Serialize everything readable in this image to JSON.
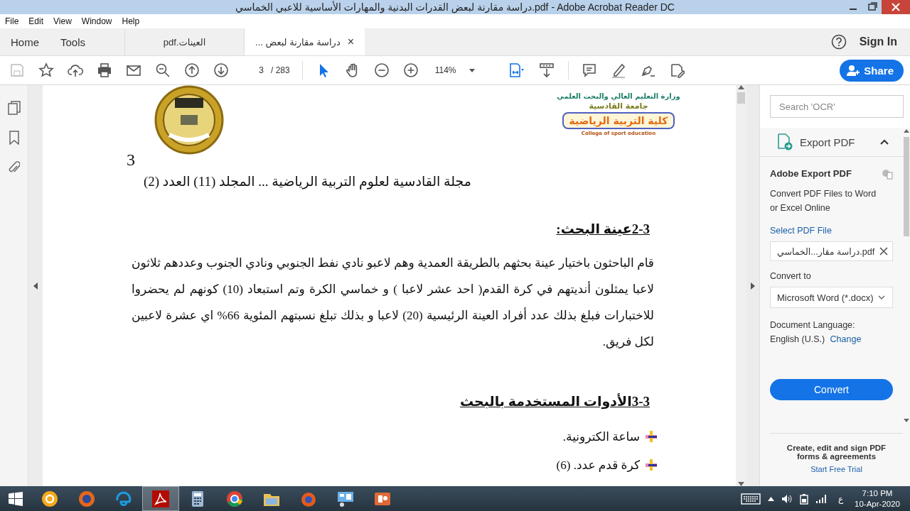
{
  "window": {
    "title": "دراسة مقارنة لبعض القدرات البدنية والمهارات الأساسية للاعبي الخماسي.pdf - Adobe Acrobat Reader DC"
  },
  "menu": {
    "file": "File",
    "edit": "Edit",
    "view": "View",
    "window": "Window",
    "help": "Help"
  },
  "home_tab": {
    "label": "Home",
    "kind": "nav",
    "selected": false
  },
  "tools_tab": {
    "label": "Tools",
    "kind": "nav",
    "selected": false
  },
  "other_document_tab": {
    "label": "العينات.pdf",
    "kind": "document",
    "selected": false
  },
  "open_document_tab": {
    "label": "دراسة مقارنة لبعض ...",
    "kind": "document",
    "selected": true,
    "close": "×"
  },
  "account": {
    "sign_in": "Sign In"
  },
  "toolbar": {
    "page": "3",
    "page_total": "/ 283",
    "zoom": "114%",
    "share": "Share"
  },
  "document": {
    "page_number": "3",
    "logo_lines": [
      "وزارة التعليم العالي والبحث العلمي",
      "جامعة القادسية",
      "كلية التربية الرياضية",
      "College of sport education"
    ],
    "journal_line": "مجلة القادسية لعلوم التربية الرياضية  ... المجلد (11) العدد (2)",
    "sections": [
      {
        "heading": "2-3عينة البحث:",
        "paragraph": "قام الباحثون باختيار عينة بحثهم بالطريقة العمدية وهم لاعبو نادي نفط الجنوبي ونادي الجنوب وعددهم ثلاثون لاعبا يمثلون أنديتهم في كرة القدم( احد عشر لاعبا ) و خماسي الكرة وتم استبعاد (10) كونهم لم يحضروا للاختبارات فبلغ بذلك عدد أفراد العينة الرئيسية (20) لاعبا و بذلك تبلغ نسبتهم المئوية 66% اي عشرة لاعبين لكل فريق."
      },
      {
        "heading": "3-3الأدوات المستخدمة بالبحث",
        "bullets": [
          "ساعة الكترونية.",
          "كرة قدم عدد. (6)"
        ]
      }
    ]
  },
  "panel": {
    "search_placeholder": "Search 'OCR'",
    "tool": "Export PDF",
    "expanded": true,
    "title": "Adobe Export PDF",
    "description": "Convert PDF Files to Word or Excel Online",
    "select_link": "Select PDF File",
    "file": "دراسة مقار...الخماسي.pdf",
    "convert_to_label": "Convert to",
    "format": "Microsoft Word (*.docx)",
    "language_label": "Document Language:",
    "language": "English (U.S.)",
    "change_link": "Change",
    "convert_button": "Convert",
    "promo": "Create, edit and sign PDF forms & agreements",
    "trial_link": "Start Free Trial"
  },
  "taskbar": {
    "apps": [
      {
        "selected": false
      },
      {
        "selected": false
      },
      {
        "selected": false
      },
      {
        "selected": true
      },
      {
        "selected": false
      },
      {
        "selected": false
      },
      {
        "selected": false
      },
      {
        "selected": false
      },
      {
        "selected": false
      },
      {
        "selected": false
      }
    ],
    "language": "ع",
    "time": "7:10 PM",
    "date": "10-Apr-2020"
  }
}
